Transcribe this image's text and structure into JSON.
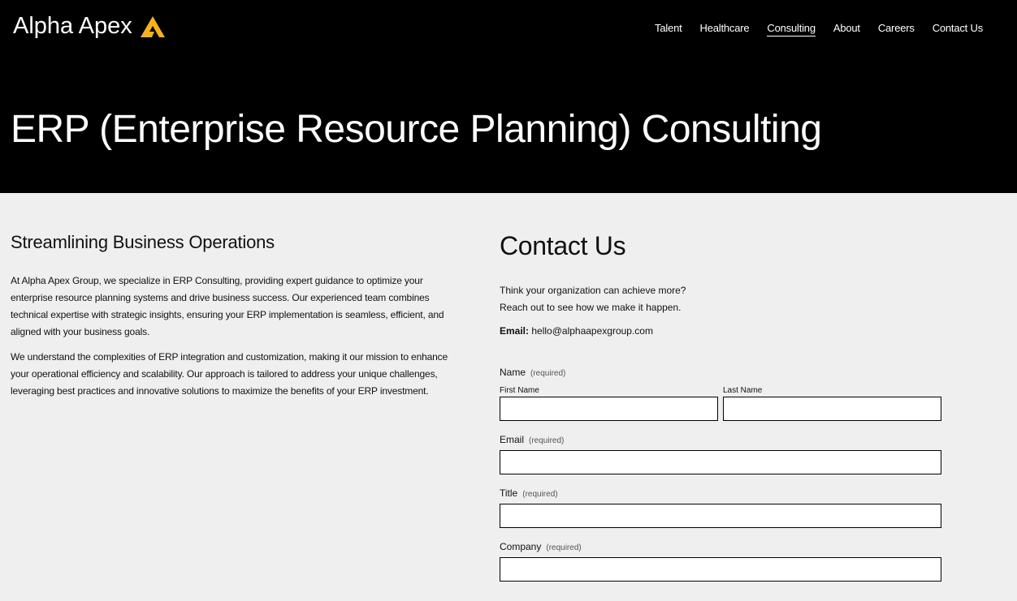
{
  "brand": {
    "name": "Alpha Apex",
    "logo_icon": "triangle-logo-icon",
    "logo_color": "#f5b21e"
  },
  "nav": {
    "items": [
      {
        "label": "Talent",
        "active": false
      },
      {
        "label": "Healthcare",
        "active": false
      },
      {
        "label": "Consulting",
        "active": true
      },
      {
        "label": "About",
        "active": false
      },
      {
        "label": "Careers",
        "active": false
      },
      {
        "label": "Contact Us",
        "active": false
      }
    ]
  },
  "hero": {
    "title": "ERP (Enterprise Resource Planning) Consulting"
  },
  "about": {
    "heading": "Streamlining Business Operations",
    "paragraphs": [
      "At Alpha Apex Group, we specialize in ERP Consulting, providing expert guidance to optimize your enterprise resource planning systems and drive business success. Our experienced team combines technical expertise with strategic insights, ensuring your ERP implementation is seamless, efficient, and aligned with your business goals.",
      "We understand the complexities of ERP integration and customization, making it our mission to enhance your operational efficiency and scalability. Our approach is tailored to address your unique challenges, leveraging best practices and innovative solutions to maximize the benefits of your ERP investment."
    ]
  },
  "contact": {
    "heading": "Contact Us",
    "intro_line1": "Think your organization can achieve more?",
    "intro_line2": "Reach out to see how we make it happen.",
    "email_label": "Email:",
    "email_value": "hello@alphaapexgroup.com",
    "form": {
      "required_text": "(required)",
      "name_label": "Name",
      "first_name_label": "First Name",
      "first_name_value": "",
      "last_name_label": "Last Name",
      "last_name_value": "",
      "email_label": "Email",
      "email_value": "",
      "title_label": "Title",
      "title_value": "",
      "company_label": "Company",
      "company_value": ""
    }
  },
  "colors": {
    "hero_bg": "#000000",
    "page_bg": "#efefef",
    "accent": "#f5b21e"
  }
}
